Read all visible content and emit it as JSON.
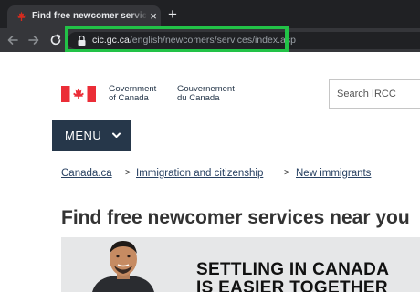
{
  "browser": {
    "tab": {
      "title": "Find free newcomer services nea",
      "close": "×"
    },
    "new_tab": "+",
    "url": {
      "host": "cic.gc.ca",
      "path": "/english/newcomers/services/index.asp"
    }
  },
  "header": {
    "wordmark_en": [
      "Government",
      "of Canada"
    ],
    "wordmark_fr": [
      "Gouvernement",
      "du Canada"
    ],
    "search_placeholder": "Search IRCC"
  },
  "menu": {
    "label": "MENU"
  },
  "breadcrumbs": {
    "items": [
      "Canada.ca",
      "Immigration and citizenship",
      "New immigrants"
    ],
    "separator": ">"
  },
  "page": {
    "title": "Find free newcomer services near you"
  },
  "banner": {
    "lines": [
      "SETTLING IN CANADA",
      "IS EASIER TOGETHER"
    ]
  },
  "colors": {
    "highlight": "#22c247",
    "gc_navy": "#26374a",
    "flag_red": "#eb2d37"
  }
}
